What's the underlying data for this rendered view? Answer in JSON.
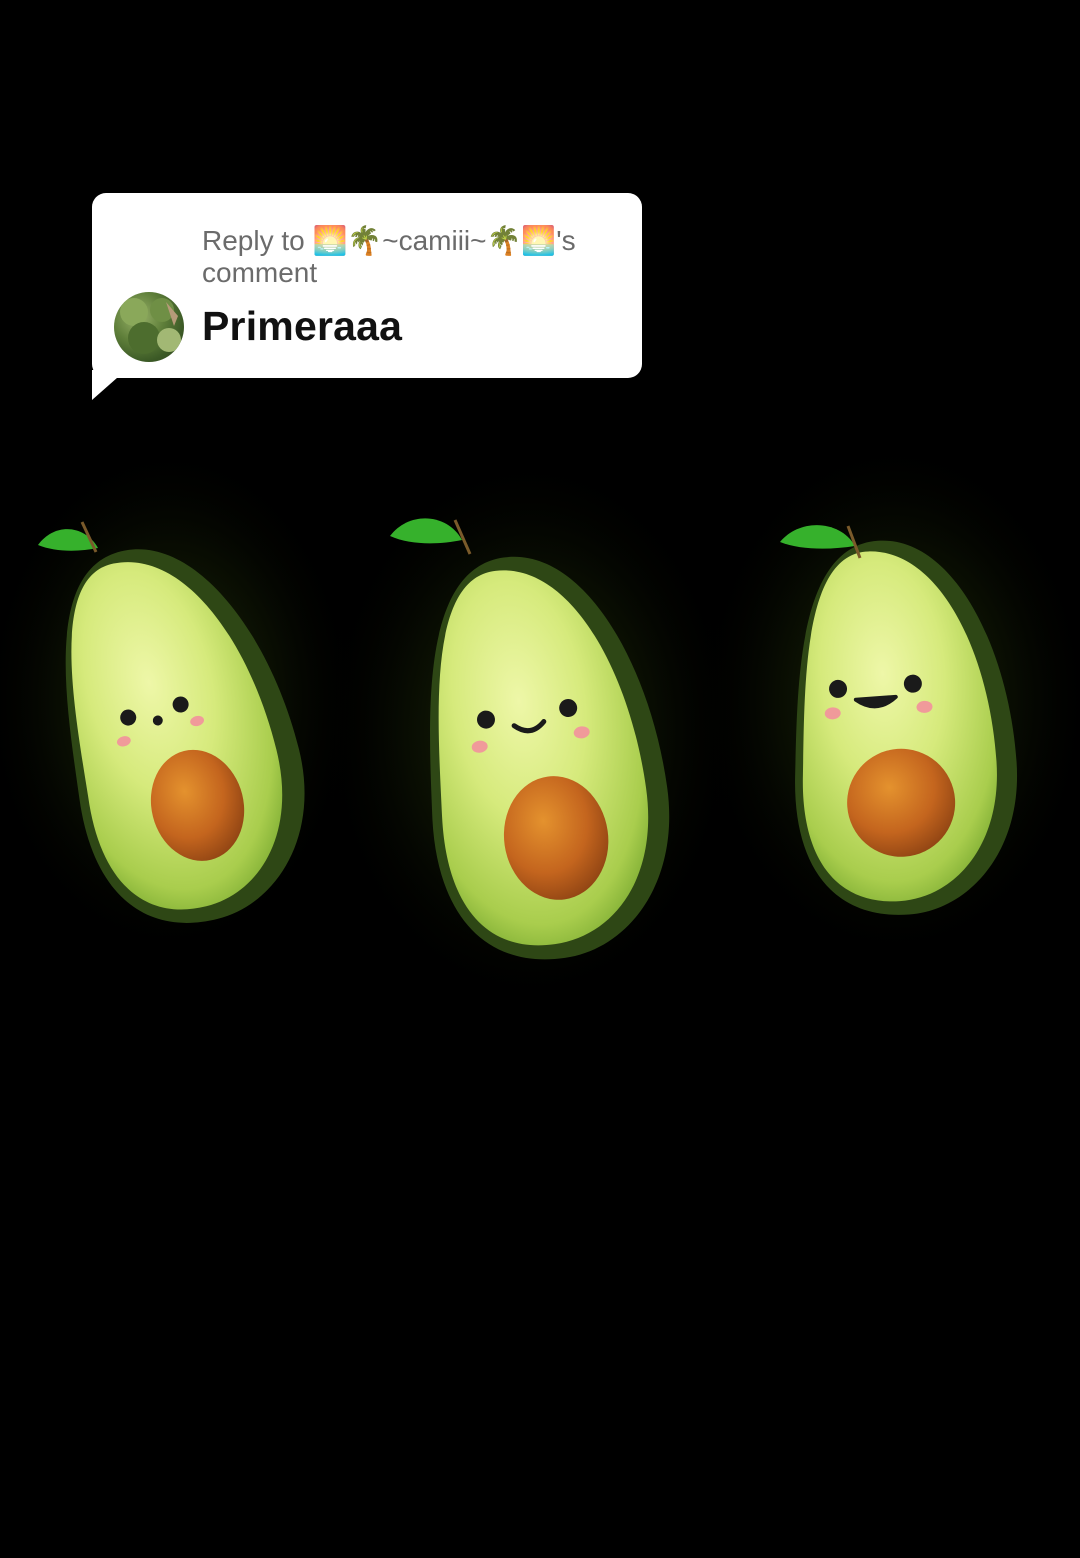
{
  "reply_sticker": {
    "prefix": "Reply to",
    "username": "🌅🌴~camiii~🌴🌅",
    "suffix": "'s comment",
    "comment": "Primeraaa",
    "avatar": "user-avatar"
  },
  "scene": {
    "subject_count": 3,
    "colors": {
      "background": "#000000",
      "flesh": "#c9e36a",
      "skin": "#3b5a1d",
      "pit": "#c8661e",
      "leaf": "#36b12c",
      "cheek": "#f09a9a"
    }
  }
}
